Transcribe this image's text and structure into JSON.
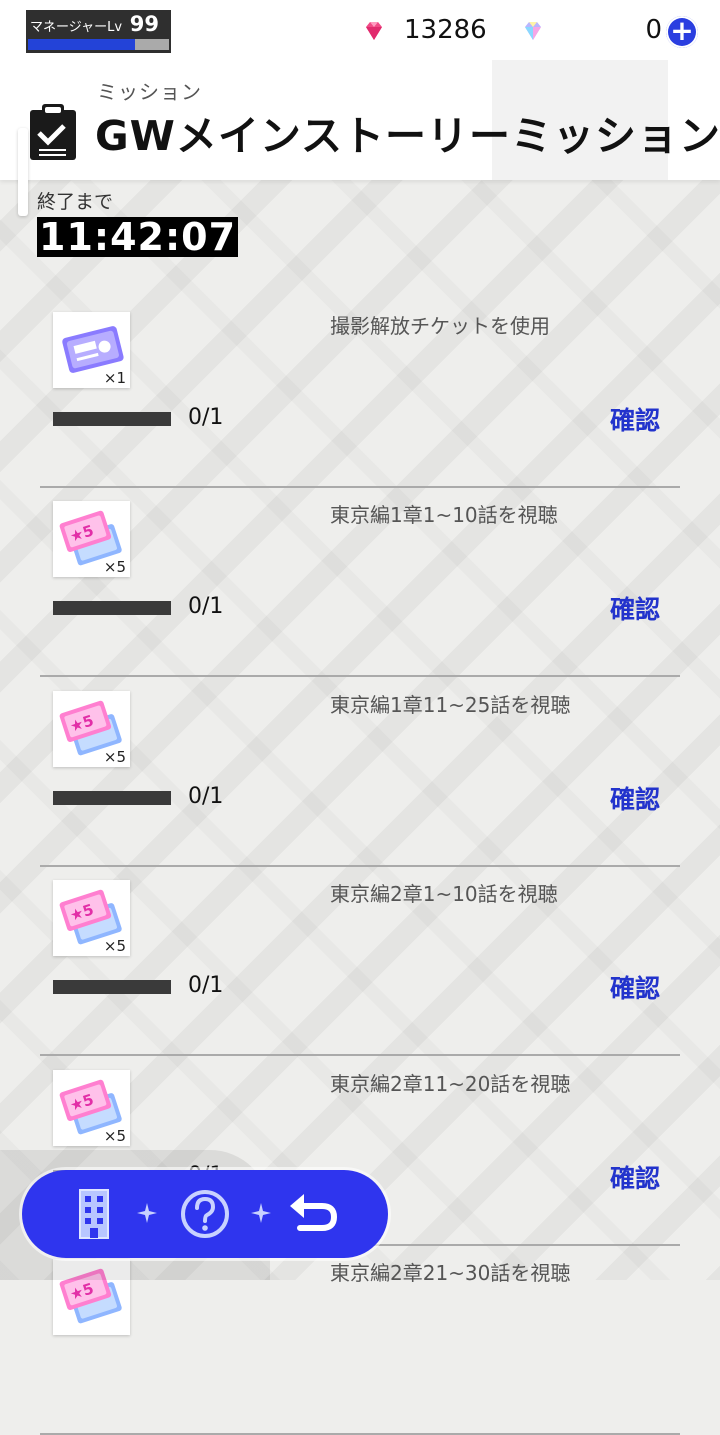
{
  "status": {
    "manager_label": "マネージャーLv",
    "manager_level": "99",
    "level_progress": 0.76,
    "paid_gems": "13286",
    "free_gems": "0",
    "paid_gem_icon": "pink-diamond-icon",
    "free_gem_icon": "rainbow-diamond-icon",
    "plus_icon": "plus-circle-icon"
  },
  "header": {
    "subtitle": "ミッション",
    "title": "GWメインストーリーミッション",
    "icon": "clipboard-check-icon"
  },
  "timer": {
    "label": "終了まで",
    "value": "11:42:07"
  },
  "missions": [
    {
      "title": "撮影解放チケットを使用",
      "reward_icon": "story-ticket-icon",
      "reward_qty": "×1",
      "progress_text": "0/1",
      "progress": 0,
      "action": "確認"
    },
    {
      "title": "東京編1章1~10話を視聴",
      "reward_icon": "star5-ticket-icon",
      "reward_qty": "×5",
      "progress_text": "0/1",
      "progress": 0,
      "action": "確認"
    },
    {
      "title": "東京編1章11~25話を視聴",
      "reward_icon": "star5-ticket-icon",
      "reward_qty": "×5",
      "progress_text": "0/1",
      "progress": 0,
      "action": "確認"
    },
    {
      "title": "東京編2章1~10話を視聴",
      "reward_icon": "star5-ticket-icon",
      "reward_qty": "×5",
      "progress_text": "0/1",
      "progress": 0,
      "action": "確認"
    },
    {
      "title": "東京編2章11~20話を視聴",
      "reward_icon": "star5-ticket-icon",
      "reward_qty": "×5",
      "progress_text": "0/1",
      "progress": 0,
      "action": "確認"
    },
    {
      "title": "東京編2章21~30話を視聴",
      "reward_icon": "star5-ticket-icon",
      "reward_qty": "",
      "progress_text": "",
      "progress": 0,
      "action": ""
    }
  ],
  "nav": {
    "home_icon": "building-icon",
    "help_icon": "question-circle-icon",
    "back_icon": "return-arrow-icon"
  },
  "colors": {
    "accent": "#2f35ee",
    "link": "#2233cc",
    "progress_track": "#3a3a3a",
    "background": "#eeeeec"
  }
}
